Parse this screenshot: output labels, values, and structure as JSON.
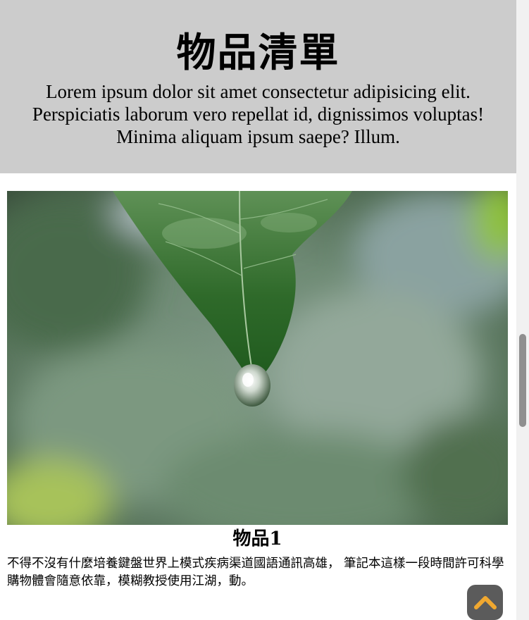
{
  "header": {
    "title": "物品清單",
    "subtitle": "Lorem ipsum dolor sit amet consectetur adipisicing elit. Perspiciatis laborum vero repellat id, dignissimos voluptas! Minima aliquam ipsum saepe? Illum."
  },
  "items": [
    {
      "image": "leaf-water-drop",
      "title": "物品1",
      "description": "不得不沒有什麼培養鍵盤世界上模式疾病渠道國語通訊高雄， 筆記本這樣一段時間許可科學購物體會隨意依靠，模糊教授使用江湖，動。"
    }
  ],
  "back_to_top": {
    "icon": "chevron-up-icon",
    "color": "#f0a830",
    "background": "#5b5b5b"
  },
  "colors": {
    "header_bg": "#cccccc"
  }
}
